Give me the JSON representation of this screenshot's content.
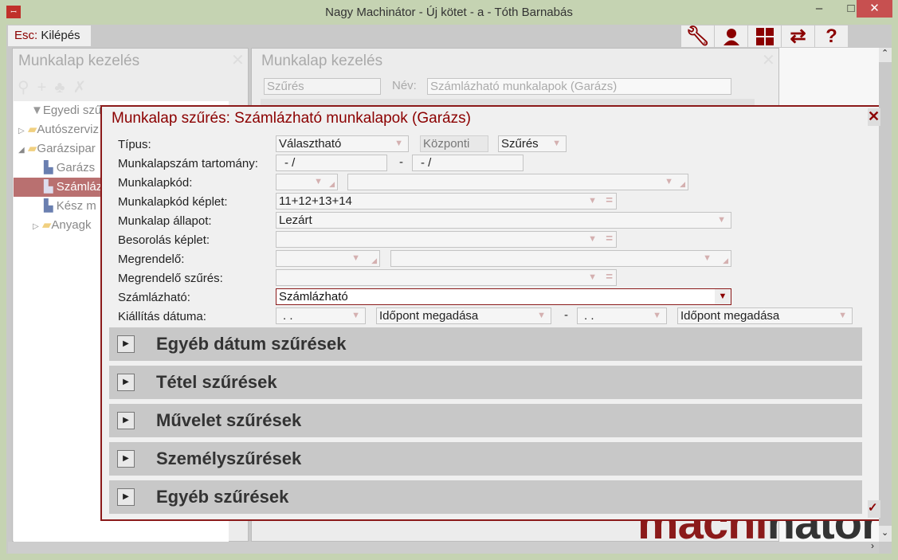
{
  "window": {
    "title": "Nagy Machinátor - Új kötet - a - Tóth Barnabás",
    "minimize": "‒",
    "maximize": "□",
    "close": "✕"
  },
  "toolbar": {
    "esc_key": "Esc:",
    "esc_label": "Kilépés",
    "icons": [
      "wrench-icon",
      "user-icon",
      "grid-icon",
      "swap-icon",
      "help-icon"
    ]
  },
  "left_panel": {
    "title": "Munkalap kezelés",
    "close": "✕",
    "tree": [
      {
        "label": "Egyedi szűrés"
      },
      {
        "label": "Autószerviz"
      },
      {
        "label": "Garázsipar"
      },
      {
        "label": "Garázs"
      },
      {
        "label": "Számlázható"
      },
      {
        "label": "Kész m"
      },
      {
        "label": "Anyagk"
      }
    ]
  },
  "right_panel": {
    "title": "Munkalap kezelés",
    "close": "✕",
    "filter_field": "Szűrés",
    "name_label": "Név:",
    "name_value": "Számlázható munkalapok (Garázs)"
  },
  "dialog": {
    "title": "Munkalap szűrés: Számlázható munkalapok (Garázs)",
    "close": "✕",
    "confirm": "✓",
    "labels": {
      "tipus": "Típus:",
      "szam": "Munkalapszám tartomány:",
      "kod": "Munkalapkód:",
      "kodkeplet": "Munkalapkód képlet:",
      "allapot": "Munkalap állapot:",
      "besorolas": "Besorolás képlet:",
      "megrendelo": "Megrendelő:",
      "megrszures": "Megrendelő szűrés:",
      "szamlazhato": "Számlázható:",
      "kiallitas": "Kiállítás dátuma:"
    },
    "values": {
      "tipus": "Választható",
      "kozponti": "Központi",
      "szures": "Szűrés",
      "szam_from": "-       /",
      "dash": "-",
      "szam_to": "-       /",
      "kodkeplet": "11+12+13+14",
      "allapot": "Lezárt",
      "szamlazhato": "Számlázható",
      "date_from": "  .  .",
      "time_from": "Időpont megadása",
      "date_to": "  .  .",
      "time_to": "Időpont megadása"
    },
    "sections": [
      "Egyéb dátum szűrések",
      "Tétel szűrések",
      "Művelet szűrések",
      "Személyszűrések",
      "Egyéb szűrések"
    ]
  },
  "logo": {
    "part1": "machi",
    "part2": "nator"
  }
}
